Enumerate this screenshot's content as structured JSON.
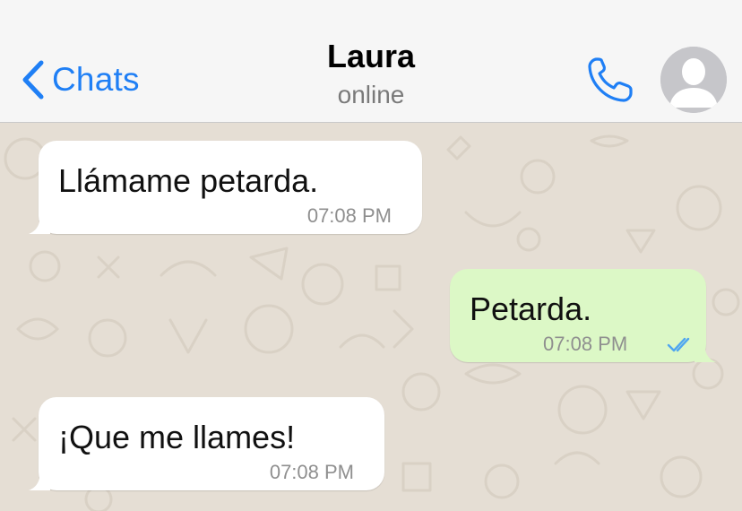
{
  "header": {
    "back_label": "Chats",
    "contact_name": "Laura",
    "contact_status": "online",
    "icons": {
      "back": "chevron-left-icon",
      "call": "phone-icon",
      "avatar": "default-avatar-icon"
    },
    "colors": {
      "accent": "#1f7ff5",
      "bar": "#f6f6f6"
    }
  },
  "messages": [
    {
      "direction": "incoming",
      "text": "Llámame petarda.",
      "time": "07:08 PM"
    },
    {
      "direction": "outgoing",
      "text": "Petarda.",
      "time": "07:08 PM",
      "status_icon": "double-check-read-icon"
    },
    {
      "direction": "incoming",
      "text": "¡Que me llames!",
      "time": "07:08 PM"
    }
  ],
  "colors": {
    "wallpaper": "#e5ded4",
    "incoming_bubble": "#ffffff",
    "outgoing_bubble": "#dcf8c6",
    "read_ticks": "#4fa6f0"
  }
}
